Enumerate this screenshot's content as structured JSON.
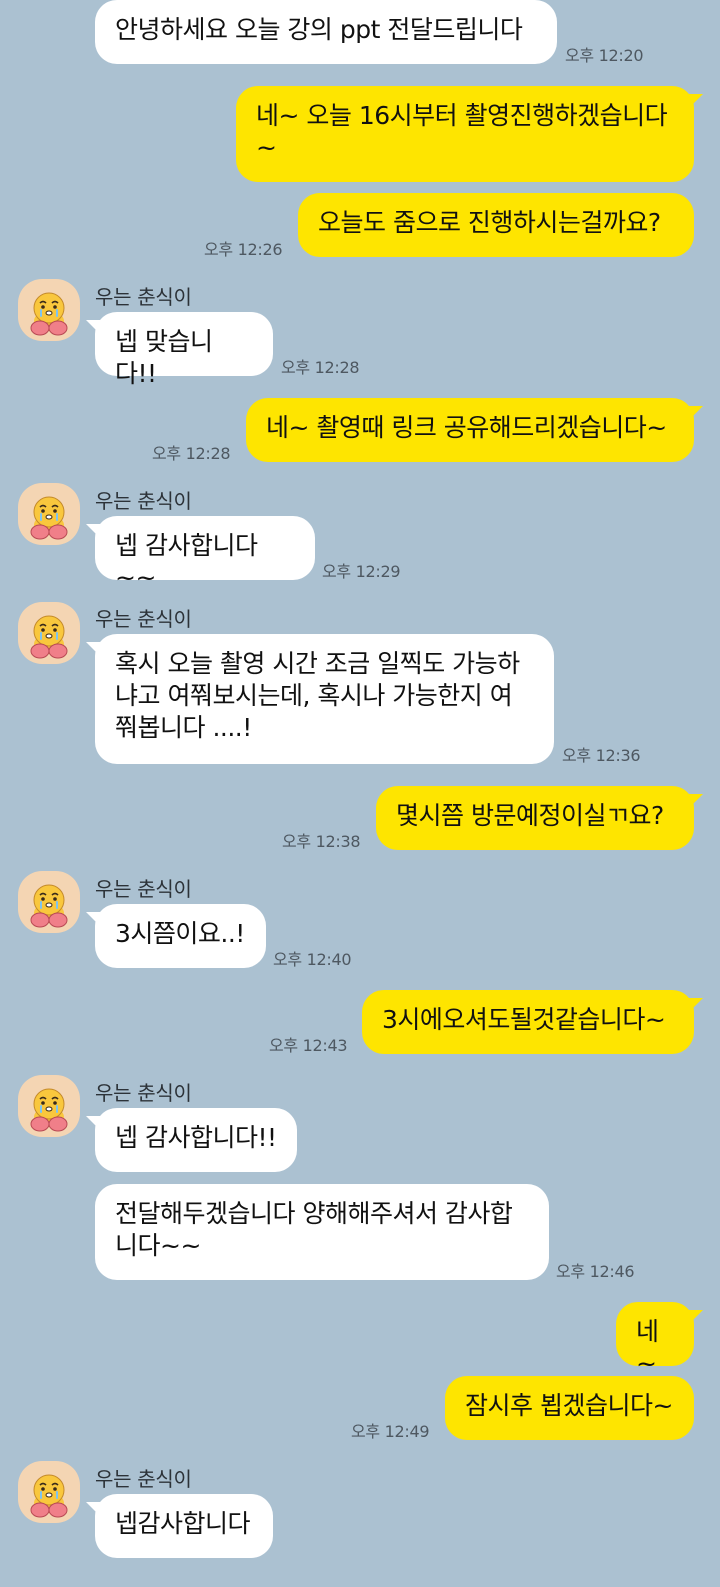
{
  "colors": {
    "background": "#abc1d1",
    "incoming_bubble": "#ffffff",
    "outgoing_bubble": "#fee500",
    "avatar_bg": "#f4d5b3",
    "character_yellow": "#f9c73d",
    "character_pink": "#f07f89"
  },
  "contact": {
    "name": "우는 춘식이",
    "avatar_icon": "crying-choonsik-icon"
  },
  "messages": [
    {
      "dir": "in",
      "text": "안녕하세요 오늘 강의 ppt 전달드립니다",
      "time": "오후 12:20"
    },
    {
      "dir": "out",
      "text": "네~ 오늘 16시부터 촬영진행하겠습니다~",
      "time": ""
    },
    {
      "dir": "out",
      "text": "오늘도 줌으로 진행하시는걸까요?",
      "time": "오후 12:26"
    },
    {
      "dir": "in",
      "sender": "우는 춘식이",
      "text": "넵 맞습니다!!",
      "time": "오후 12:28"
    },
    {
      "dir": "out",
      "text": "네~ 촬영때 링크 공유해드리겠습니다~",
      "time": "오후 12:28"
    },
    {
      "dir": "in",
      "sender": "우는 춘식이",
      "text": "넵 감사합니다~~",
      "time": "오후 12:29"
    },
    {
      "dir": "in",
      "sender": "우는 춘식이",
      "text": "혹시 오늘 촬영 시간 조금 일찍도 가능하냐고 여쭤보시는데, 혹시나 가능한지 여쭤봅니다 ....!",
      "time": "오후 12:36"
    },
    {
      "dir": "out",
      "text": "몇시쯤 방문예정이실ㄲ요?",
      "time": "오후 12:38"
    },
    {
      "dir": "in",
      "sender": "우는 춘식이",
      "text": "3시쯤이요..!",
      "time": "오후 12:40"
    },
    {
      "dir": "out",
      "text": "3시에오셔도될것같습니다~",
      "time": "오후 12:43"
    },
    {
      "dir": "in",
      "sender": "우는 춘식이",
      "text": "넵 감사합니다!!",
      "time": ""
    },
    {
      "dir": "in",
      "text": "전달해두겠습니다 양해해주셔서 감사합니다~~",
      "time": "오후 12:46"
    },
    {
      "dir": "out",
      "text": "네~",
      "time": ""
    },
    {
      "dir": "out",
      "text": "잠시후 뵙겠습니다~",
      "time": "오후 12:49"
    },
    {
      "dir": "in",
      "sender": "우는 춘식이",
      "text": "넵감사합니다",
      "time": ""
    }
  ]
}
